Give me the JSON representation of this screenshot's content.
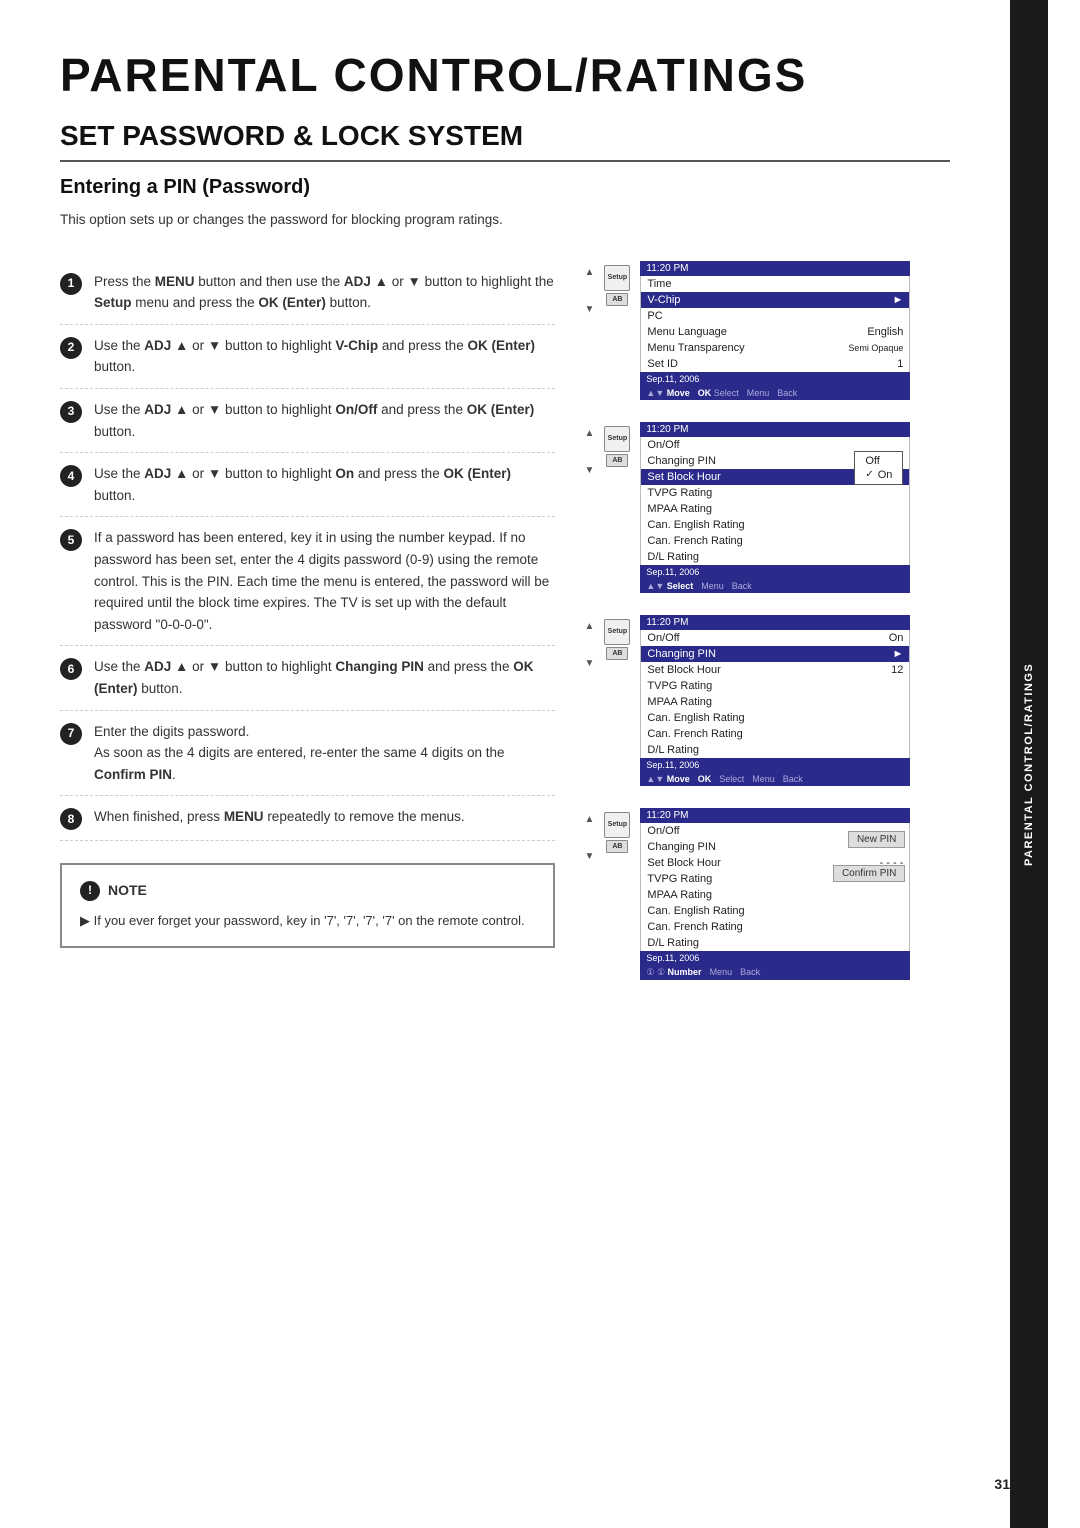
{
  "page": {
    "title": "PARENTAL CONTROL/RATINGS",
    "section": "SET PASSWORD & LOCK SYSTEM",
    "subsection": "Entering a PIN (Password)",
    "intro": "This option sets up or changes the password for blocking program ratings.",
    "page_number": "31",
    "side_tab": "PARENTAL CONTROL/RATINGS"
  },
  "steps": [
    {
      "number": "1",
      "text": "Press the MENU button and then use the ADJ ▲ or ▼ button to highlight the Setup menu and press the OK (Enter) button."
    },
    {
      "number": "2",
      "text": "Use the ADJ ▲ or ▼ button to highlight V-Chip and press the OK (Enter) button."
    },
    {
      "number": "3",
      "text": "Use the ADJ ▲ or ▼ button to highlight On/Off and press the OK (Enter) button."
    },
    {
      "number": "4",
      "text": "Use the ADJ ▲ or ▼ button to highlight On and press the OK (Enter) button."
    },
    {
      "number": "5",
      "text": "If a password has been entered, key it in using the number keypad. If no password has been set, enter the 4 digits password (0-9) using the remote control. This is the PIN. Each time the menu is entered, the password will be required until the block time expires. The TV is set up with the default password \"0-0-0-0\"."
    },
    {
      "number": "6",
      "text": "Use the ADJ ▲ or ▼ button to highlight Changing PIN and press the OK (Enter) button."
    },
    {
      "number": "7",
      "text": "Enter the digits password.\nAs soon as the 4 digits are entered, re-enter the same 4 digits on the Confirm PIN."
    },
    {
      "number": "8",
      "text": "When finished, press MENU repeatedly to remove the menus."
    }
  ],
  "note": {
    "header": "NOTE",
    "text": "If you ever forget your password, key in '7', '7', '7', '7' on the remote control."
  },
  "screens": [
    {
      "id": "screen1",
      "status_time": "11:20 PM",
      "status_date": "Sep.11, 2006",
      "menu_items": [
        {
          "label": "Time",
          "value": "",
          "highlighted": false
        },
        {
          "label": "V-Chip",
          "value": "►",
          "highlighted": true
        },
        {
          "label": "PC",
          "value": "",
          "highlighted": false
        },
        {
          "label": "Menu Language",
          "value": "English",
          "highlighted": false
        },
        {
          "label": "Menu Transparency",
          "value": "Semi Opaque",
          "highlighted": false
        },
        {
          "label": "Set ID",
          "value": "1",
          "highlighted": false
        }
      ],
      "bottom_bar": "▲▼ Move    OK Select    Menu    Back"
    },
    {
      "id": "screen2",
      "status_time": "11:20 PM",
      "status_date": "Sep.11, 2006",
      "menu_items": [
        {
          "label": "On/Off",
          "value": "",
          "highlighted": false
        },
        {
          "label": "Changing PIN",
          "value": "",
          "highlighted": false
        },
        {
          "label": "Set Block Hour",
          "value": "",
          "highlighted": true
        },
        {
          "label": "TVPG Rating",
          "value": "",
          "highlighted": false
        },
        {
          "label": "MPAA Rating",
          "value": "",
          "highlighted": false
        },
        {
          "label": "Can. English Rating",
          "value": "",
          "highlighted": false
        },
        {
          "label": "Can. French Rating",
          "value": "",
          "highlighted": false
        },
        {
          "label": "D/L Rating",
          "value": "",
          "highlighted": false
        }
      ],
      "popup": [
        "Off",
        "On"
      ],
      "popup_checked": "On",
      "bottom_bar": "▲▼ Select    Menu    Back"
    },
    {
      "id": "screen3",
      "status_time": "11:20 PM",
      "status_date": "Sep.11, 2006",
      "menu_items": [
        {
          "label": "On/Off",
          "value": "On",
          "highlighted": false
        },
        {
          "label": "Changing PIN",
          "value": "►",
          "highlighted": true
        },
        {
          "label": "Set Block Hour",
          "value": "12",
          "highlighted": false
        },
        {
          "label": "TVPG Rating",
          "value": "",
          "highlighted": false
        },
        {
          "label": "MPAA Rating",
          "value": "",
          "highlighted": false
        },
        {
          "label": "Can. English Rating",
          "value": "",
          "highlighted": false
        },
        {
          "label": "Can. French Rating",
          "value": "",
          "highlighted": false
        },
        {
          "label": "D/L Rating",
          "value": "",
          "highlighted": false
        }
      ],
      "bottom_bar": "▲▼ Move    OK    Select    Menu    Back"
    },
    {
      "id": "screen4",
      "status_time": "11:20 PM",
      "status_date": "Sep.11, 2006",
      "menu_items": [
        {
          "label": "On/Off",
          "value": "",
          "highlighted": false
        },
        {
          "label": "Changing PIN",
          "value": "",
          "highlighted": false
        },
        {
          "label": "Set Block Hour",
          "value": "- - - -",
          "highlighted": false
        },
        {
          "label": "TVPG Rating",
          "value": "",
          "highlighted": false
        },
        {
          "label": "MPAA Rating",
          "value": "",
          "highlighted": false
        },
        {
          "label": "Can. English Rating",
          "value": "",
          "highlighted": false
        },
        {
          "label": "Can. French Rating",
          "value": "",
          "highlighted": false
        },
        {
          "label": "D/L Rating",
          "value": "",
          "highlighted": false
        }
      ],
      "new_pin_label": "New PIN",
      "confirm_pin_label": "Confirm PIN",
      "bottom_bar": "① ① Number    Menu    Back"
    }
  ]
}
